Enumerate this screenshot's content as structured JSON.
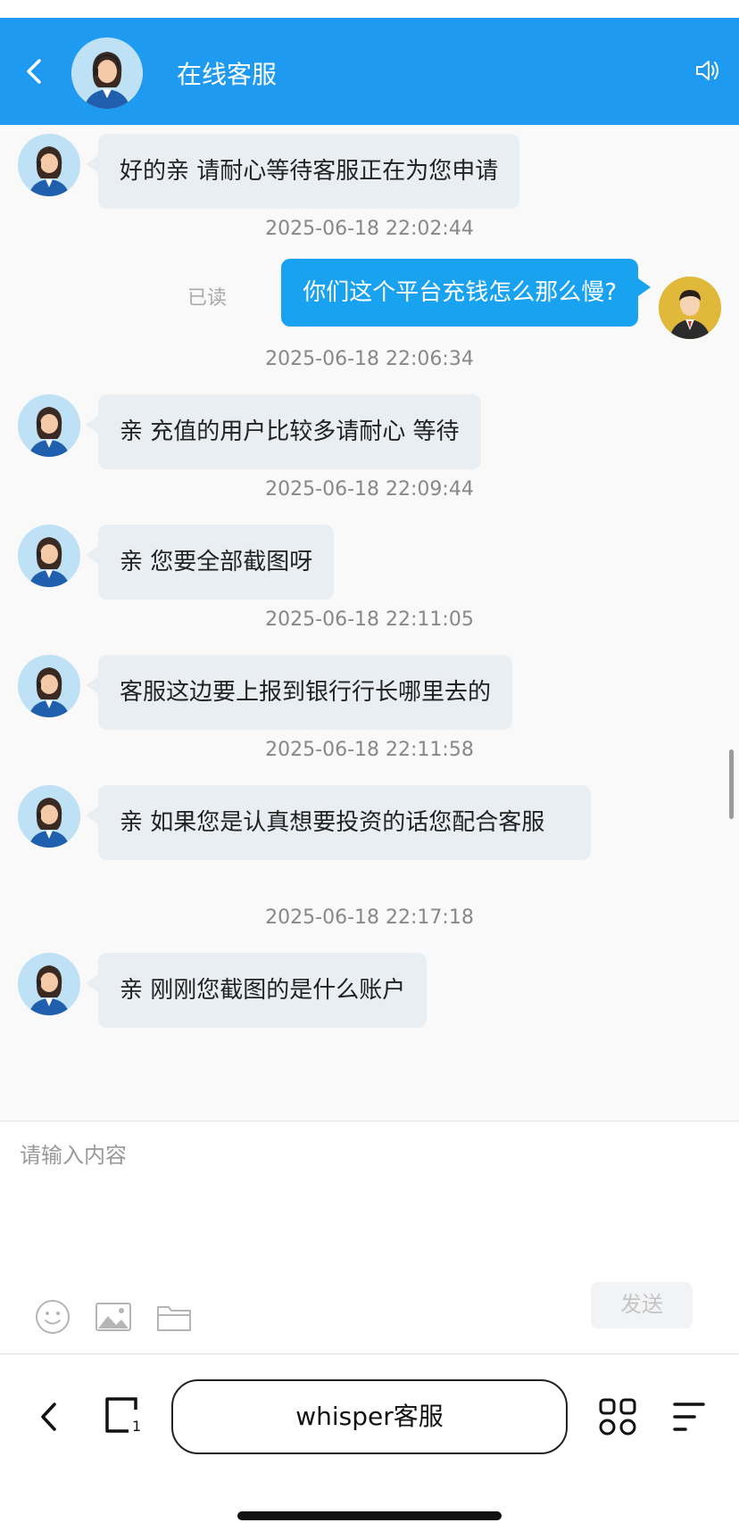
{
  "header": {
    "title": "在线客服",
    "color": "#1e9bf0",
    "icons": [
      "back-arrow-icon",
      "agent-avatar",
      "speaker-icon"
    ]
  },
  "messages": [
    {
      "type": "incoming",
      "text": "好的亲 请耐心等待客服正在为您申请"
    },
    {
      "type": "timestamp",
      "text": "2025-06-18 22:02:44"
    },
    {
      "type": "outgoing",
      "text": "你们这个平台充钱怎么那么慢?",
      "status": "已读"
    },
    {
      "type": "timestamp",
      "text": "2025-06-18 22:06:34"
    },
    {
      "type": "incoming",
      "text": "亲 充值的用户比较多请耐心 等待"
    },
    {
      "type": "timestamp",
      "text": "2025-06-18 22:09:44"
    },
    {
      "type": "incoming",
      "text": "亲 您要全部截图呀"
    },
    {
      "type": "timestamp",
      "text": "2025-06-18 22:11:05"
    },
    {
      "type": "incoming",
      "text": "客服这边要上报到银行行长哪里去的"
    },
    {
      "type": "timestamp",
      "text": "2025-06-18 22:11:58"
    },
    {
      "type": "incoming",
      "text": "亲 如果您是认真想要投资的话您配合客服"
    },
    {
      "type": "timestamp",
      "text": "2025-06-18 22:17:18"
    },
    {
      "type": "incoming",
      "text": "亲 刚刚您截图的是什么账户"
    }
  ],
  "input": {
    "placeholder": "请输入内容",
    "send_label": "发送",
    "tools": [
      "emoji-icon",
      "image-icon",
      "folder-icon"
    ]
  },
  "browser_bar": {
    "title": "whisper客服",
    "icons": [
      "back-icon",
      "tabs-icon",
      "apps-icon",
      "menu-icon"
    ]
  }
}
